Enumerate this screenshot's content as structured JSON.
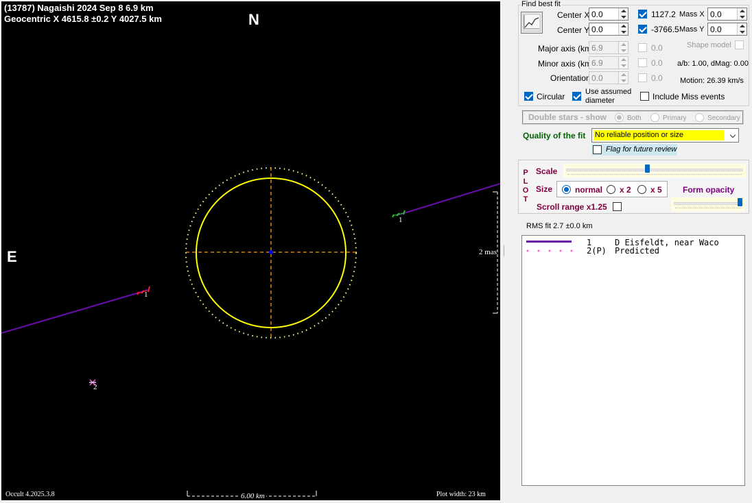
{
  "plot": {
    "title_line1": "(13787) Nagaishi  2024 Sep 8   6.9 km",
    "title_line2": "Geocentric  X  4615.8 ±0.2  Y 4027.5 km",
    "north_label": "N",
    "east_label": "E",
    "scale_bar_label": "6.00 km",
    "mas_label": "2 mas",
    "version_label": "Occult 4.2025.3.8",
    "plot_width_label": "Plot width: 23 km",
    "chord1_label_left": "1",
    "chord1_label_right": "1",
    "chord2_label": "2",
    "colors": {
      "ellipse": "#ffff00",
      "axes": "#ff9900",
      "chord1": "#6a0dad",
      "center": "#0000ff"
    }
  },
  "panel": {
    "find_best_fit_label": "Find best fit",
    "fit_button_icon": "chart-line-icon",
    "center_x_label": "Center X",
    "center_x_value": "0.0",
    "center_y_label": "Center Y",
    "center_y_value": "0.0",
    "cb_x_value": "1127.2",
    "cb_y_value": "-3766.5",
    "mass_x_label": "Mass X",
    "mass_x_value": "0.0",
    "mass_y_label": "Mass Y",
    "mass_y_value": "0.0",
    "major_axis_label": "Major axis (km)",
    "major_axis_value": "6.9",
    "minor_axis_label": "Minor axis (km)",
    "minor_axis_value": "6.9",
    "orientation_label": "Orientation",
    "orientation_value": "0.0",
    "major_cb_value": "0.0",
    "minor_cb_value": "0.0",
    "orient_cb_value": "0.0",
    "shape_model_label": "Shape model",
    "ab_label": "a/b: 1.00, dMag: 0.00",
    "motion_label": "Motion: 26.39 km/s",
    "circular_label": "Circular",
    "use_assumed_label_1": "Use assumed",
    "use_assumed_label_2": "diameter",
    "include_miss_label": "Include Miss events",
    "double_stars_label": "Double stars - show",
    "both_label": "Both",
    "primary_label": "Primary",
    "secondary_label": "Secondary",
    "quality_label": "Quality of the fit",
    "quality_value": "No reliable position or size",
    "flag_label": "Flag for future review",
    "plot_vertical": [
      "P",
      "L",
      "O",
      "T"
    ],
    "scale_label": "Scale",
    "size_label": "Size",
    "normal_label": "normal",
    "x2_label": "x 2",
    "x5_label": "x 5",
    "form_opacity_label": "Form opacity",
    "scroll_range_label": "Scroll range x1.25",
    "scale_slider_fraction": 0.46,
    "opacity_slider_fraction": 1.0,
    "rms_label": "RMS fit 2.7 ±0.0 km",
    "legend": [
      {
        "num": "1",
        "text": "D Eisfeldt, near Waco",
        "color": "#6a0dad"
      },
      {
        "num": "2(P)",
        "text": "Predicted",
        "color": "#ff66cc"
      }
    ]
  }
}
